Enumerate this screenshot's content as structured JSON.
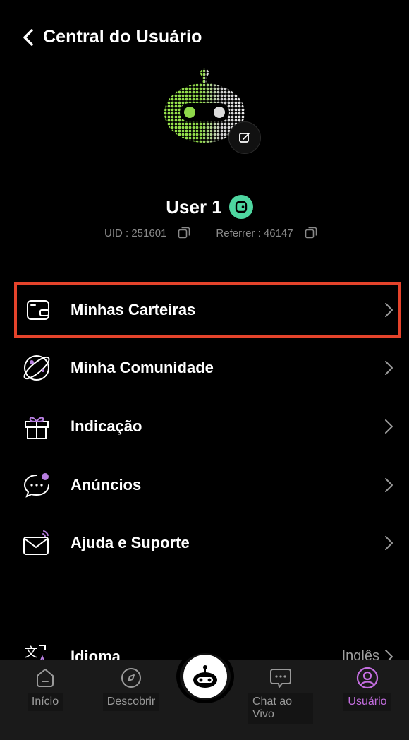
{
  "header": {
    "title": "Central do Usuário"
  },
  "profile": {
    "username": "User 1",
    "uid_label": "UID : 251601",
    "referrer_label": "Referrer : 46147"
  },
  "menu": [
    {
      "label": "Minhas Carteiras",
      "icon": "wallet-icon"
    },
    {
      "label": "Minha Comunidade",
      "icon": "planet-icon"
    },
    {
      "label": "Indicação",
      "icon": "gift-icon"
    },
    {
      "label": "Anúncios",
      "icon": "chat-bubble-icon"
    },
    {
      "label": "Ajuda e Suporte",
      "icon": "mail-icon"
    }
  ],
  "language": {
    "label": "Idioma",
    "value": "Inglês"
  },
  "nav": [
    {
      "label": "Início",
      "icon": "home-icon"
    },
    {
      "label": "Descobrir",
      "icon": "compass-icon"
    },
    {
      "label": "Chat ao Vivo",
      "icon": "chat-icon"
    },
    {
      "label": "Usuário",
      "icon": "user-icon",
      "active": true
    }
  ],
  "colors": {
    "accent": "#c46ee0",
    "highlight_border": "#e5432b",
    "verified": "#4ed6a0",
    "avatar_green": "#8fe04a"
  }
}
